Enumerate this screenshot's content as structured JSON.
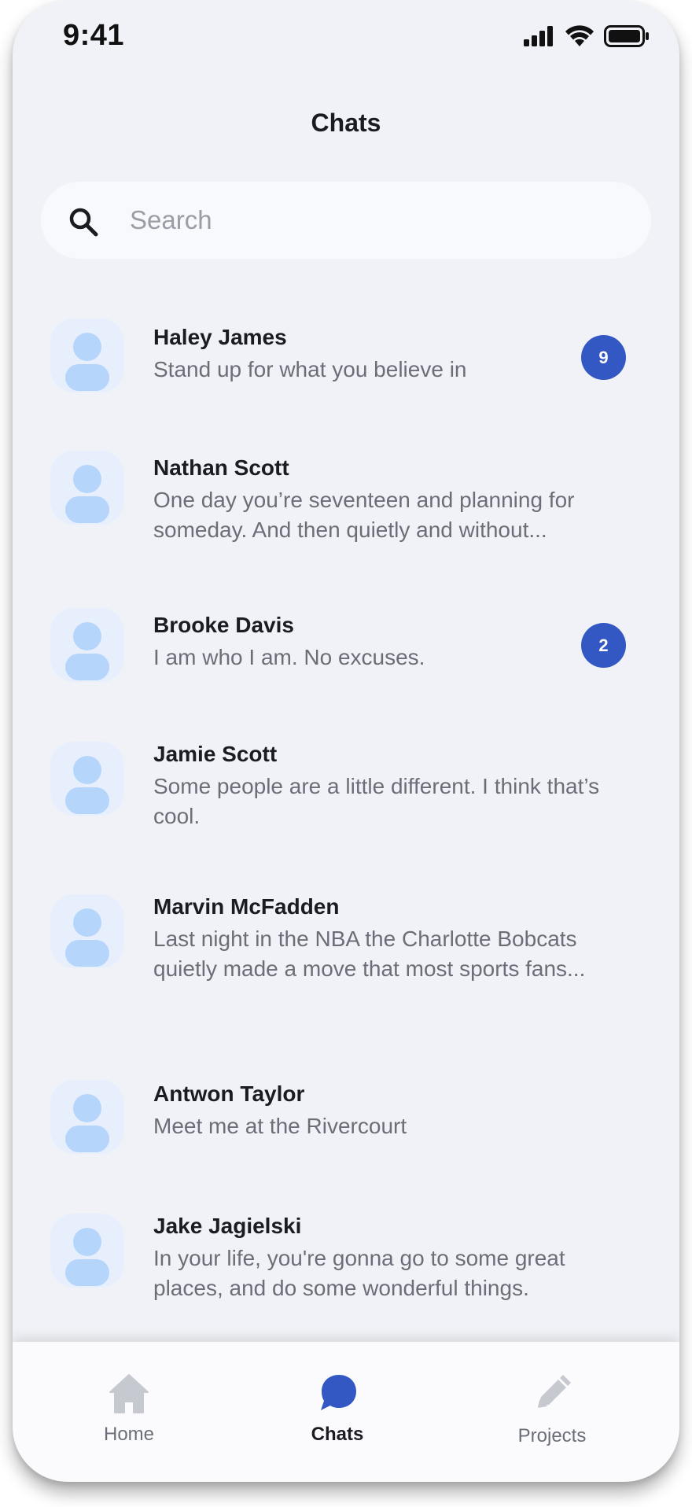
{
  "status_bar": {
    "time": "9:41"
  },
  "header": {
    "title": "Chats"
  },
  "search": {
    "placeholder": "Search",
    "value": ""
  },
  "chats": [
    {
      "name": "Haley James",
      "message": "Stand up for what you believe in",
      "unread": "9"
    },
    {
      "name": "Nathan Scott",
      "message": "One day you’re seventeen and planning for someday. And then quietly and without...",
      "unread": ""
    },
    {
      "name": "Brooke Davis",
      "message": "I am who I am. No excuses.",
      "unread": "2"
    },
    {
      "name": "Jamie Scott",
      "message": "Some people are a little different. I think that’s cool.",
      "unread": ""
    },
    {
      "name": "Marvin McFadden",
      "message": "Last night in the NBA the Charlotte Bobcats quietly made a move that most sports fans...",
      "unread": ""
    },
    {
      "name": "Antwon Taylor",
      "message": "Meet me at the Rivercourt",
      "unread": ""
    },
    {
      "name": "Jake Jagielski",
      "message": "In your life, you're gonna go to some great places, and do some wonderful things.",
      "unread": ""
    }
  ],
  "tabs": [
    {
      "label": "Home",
      "icon": "home-icon",
      "active": false
    },
    {
      "label": "Chats",
      "icon": "chat-bubble-icon",
      "active": true
    },
    {
      "label": "Projects",
      "icon": "pencil-icon",
      "active": false
    }
  ],
  "colors": {
    "accent": "#3358c4",
    "background": "#f1f2f7",
    "avatar_bg": "#e7effd",
    "avatar_figure": "#b6d5fb",
    "inactive_icon": "#c7c9d1"
  }
}
